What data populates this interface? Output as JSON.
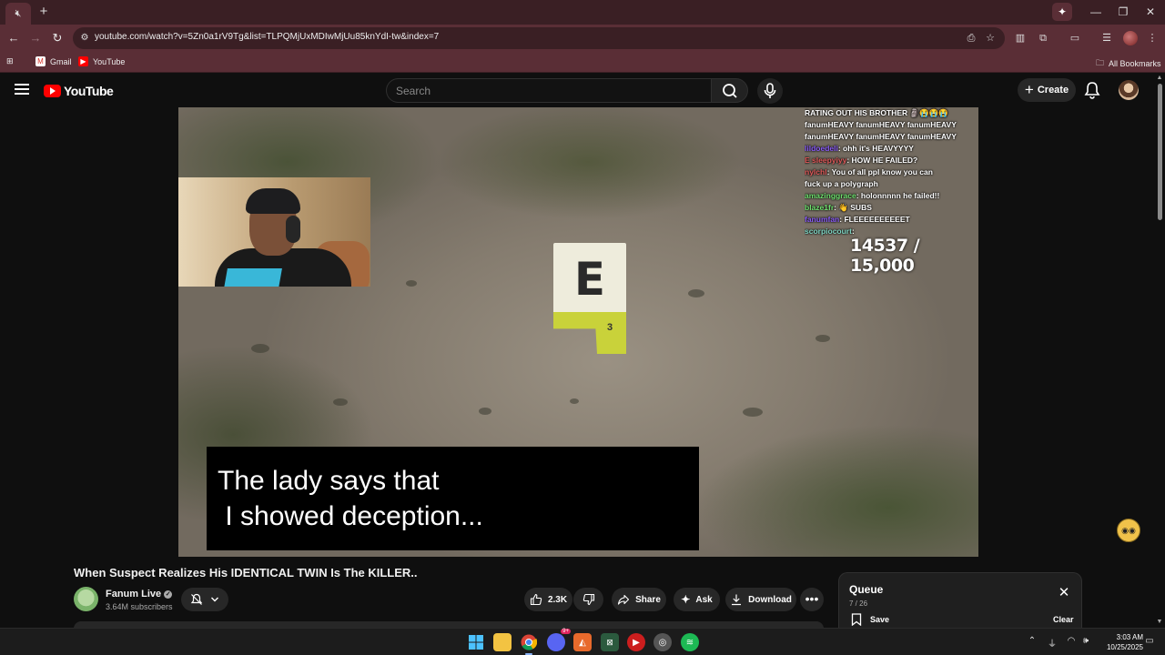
{
  "browser": {
    "url": "youtube.com/watch?v=5Zn0a1rV9Tg&list=TLPQMjUxMDIwMjUu85knYdI-tw&index=7",
    "bookmarks": [
      {
        "label": "Gmail"
      },
      {
        "label": "YouTube"
      }
    ],
    "all_bookmarks_label": "All Bookmarks",
    "tab_icon": "speaker-muted-icon",
    "colors": {
      "frame": "#3a1f24",
      "toolbar": "#5a2e36"
    }
  },
  "youtube": {
    "logo_text": "YouTube",
    "search_placeholder": "Search",
    "create_label": "Create"
  },
  "video": {
    "marker_letter": "E",
    "marker_tag_number": "3",
    "caption": "The lady says that\n I showed deception...",
    "sub_counter": "14537 / 15,000",
    "chat": [
      {
        "user": "",
        "text": "RATING OUT HIS BROTHER 🗿😭😭😭",
        "user_class": ""
      },
      {
        "user": "",
        "text": "fanumHEAVY fanumHEAVY fanumHEAVY",
        "user_class": ""
      },
      {
        "user": "",
        "text": "fanumHEAVY fanumHEAVY fanumHEAVY",
        "user_class": ""
      },
      {
        "user": "lildoedeli",
        "text": ": ohh it's HEAVYYYY",
        "user_class": ""
      },
      {
        "user": "E sleepyiyy",
        "text": ": HOW HE FAILED?",
        "user_class": "red"
      },
      {
        "user": "nylchl",
        "text": ": You of all ppl know you can",
        "user_class": "red"
      },
      {
        "user": "",
        "text": "fuck up a polygraph",
        "user_class": ""
      },
      {
        "user": "amazinggrace",
        "text": ": holonnnnn he failed!!",
        "user_class": "green"
      },
      {
        "user": "blaze1fr",
        "text": ": 👋 SUBS",
        "user_class": "green"
      },
      {
        "user": "fanumfan",
        "text": ": FLEEEEEEEEEET",
        "user_class": ""
      },
      {
        "user": "scorpiocourt",
        "text": ": ",
        "user_class": "teal"
      }
    ]
  },
  "watch": {
    "title": "When Suspect Realizes His IDENTICAL TWIN Is The KILLER..",
    "channel": "Fanum Live",
    "subscribers": "3.64M subscribers",
    "likes": "2.3K",
    "share_label": "Share",
    "ask_label": "Ask",
    "download_label": "Download",
    "more_label": "•••"
  },
  "queue": {
    "title": "Queue",
    "count": "7 / 26",
    "save_label": "Save",
    "clear_label": "Clear"
  },
  "taskbar": {
    "time": "3:03 AM",
    "date": "10/25/2025",
    "discord_badge": "9+"
  }
}
